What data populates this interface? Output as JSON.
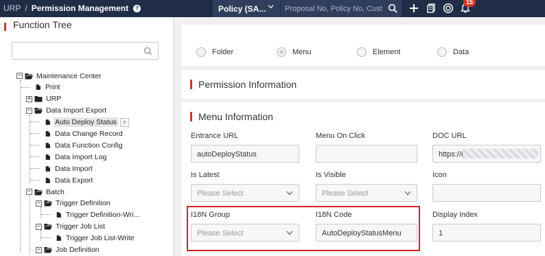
{
  "topbar": {
    "root_crumb": "URP",
    "separator": "/",
    "current_crumb": "Permission Management",
    "help_symbol": "?",
    "policy_select_value": "Policy (SA...",
    "search_placeholder": "Proposal No, Policy No, Cust",
    "notification_count": "15",
    "icons": [
      "chevron-down-icon",
      "search-icon",
      "plus-icon",
      "document-copy-icon",
      "target-icon",
      "bell-icon"
    ]
  },
  "left_panel": {
    "title": "Function Tree",
    "search_value": "",
    "add_symbol": "+",
    "tree": [
      {
        "label": "Maintenance Center",
        "toggle": "−",
        "icon": "folder-open-icon",
        "level": 0
      },
      {
        "label": "Print",
        "icon": "file-icon",
        "level": 1
      },
      {
        "label": "URP",
        "toggle": "+",
        "icon": "folder-icon",
        "level": 1
      },
      {
        "label": "Data Import Export",
        "toggle": "−",
        "icon": "folder-open-icon",
        "level": 1
      },
      {
        "label": "Auto Deploy Status",
        "icon": "file-icon",
        "level": 2,
        "selected": true
      },
      {
        "label": "Data Change Record",
        "icon": "file-icon",
        "level": 2
      },
      {
        "label": "Data Function Config",
        "icon": "file-icon",
        "level": 2
      },
      {
        "label": "Data Import Log",
        "icon": "file-icon",
        "level": 2
      },
      {
        "label": "Data Import",
        "icon": "file-icon",
        "level": 2
      },
      {
        "label": "Data Export",
        "icon": "file-icon",
        "level": 2
      },
      {
        "label": "Batch",
        "toggle": "−",
        "icon": "folder-open-icon",
        "level": 1
      },
      {
        "label": "Trigger Definition",
        "toggle": "−",
        "icon": "folder-open-icon",
        "level": 2
      },
      {
        "label": "Trigger Definition-Wri...",
        "icon": "file-icon",
        "level": 3
      },
      {
        "label": "Trigger Job List",
        "toggle": "−",
        "icon": "folder-open-icon",
        "level": 2
      },
      {
        "label": "Trigger Job List-Write",
        "icon": "file-icon",
        "level": 3
      },
      {
        "label": "Job Definition",
        "toggle": "−",
        "icon": "folder-open-icon",
        "level": 2
      }
    ]
  },
  "type_radios": [
    {
      "label": "Folder",
      "checked": false
    },
    {
      "label": "Menu",
      "checked": true
    },
    {
      "label": "Element",
      "checked": false
    },
    {
      "label": "Data",
      "checked": false
    }
  ],
  "permission_section": {
    "title": "Permission Information"
  },
  "menu_section": {
    "title": "Menu Information",
    "fields": {
      "entrance_url": {
        "label": "Entrance URL",
        "value": "autoDeployStatus"
      },
      "menu_on_click": {
        "label": "Menu On Click",
        "value": ""
      },
      "doc_url": {
        "label": "DOC URL",
        "value": "https://r"
      },
      "is_latest": {
        "label": "Is Latest",
        "value": "Please Select"
      },
      "is_visible": {
        "label": "Is Visible",
        "value": "Please Select"
      },
      "icon": {
        "label": "Icon",
        "value": ""
      },
      "i18n_group": {
        "label": "I18N Group",
        "value": "Please Select"
      },
      "i18n_code": {
        "label": "I18N Code",
        "value": "AutoDeployStatusMenu"
      },
      "display_index": {
        "label": "Display Index",
        "value": "1"
      }
    }
  },
  "colors": {
    "topbar_bg": "#1f2d47",
    "accent_red": "#c0392b",
    "highlight_red": "#d4202b",
    "badge_red": "#d9342b"
  }
}
